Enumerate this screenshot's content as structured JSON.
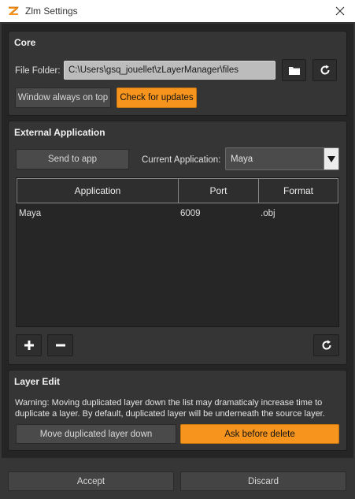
{
  "window": {
    "title": "Zlm Settings",
    "icon": "zbrush-logo-icon",
    "close_icon": "close-icon"
  },
  "core": {
    "title": "Core",
    "file_folder_label": "File Folder:",
    "file_folder_value": "C:\\Users\\gsq_jouellet\\zLayerManager\\files",
    "folder_icon": "folder-icon",
    "refresh_icon": "refresh-icon",
    "window_on_top_label": "Window always on top",
    "check_updates_label": "Check for updates"
  },
  "external": {
    "title": "External Application",
    "send_label": "Send to app",
    "current_app_label": "Current Application:",
    "current_app_value": "Maya",
    "table": {
      "columns": [
        "Application",
        "Port",
        "Format"
      ],
      "rows": [
        {
          "application": "Maya",
          "port": "6009",
          "format": ".obj"
        }
      ]
    },
    "add_icon": "plus-icon",
    "remove_icon": "minus-icon",
    "refresh_icon": "refresh-icon"
  },
  "layer_edit": {
    "title": "Layer Edit",
    "warning": "Warning: Moving duplicated layer down the list may dramaticaly increase time to duplicate a layer.  By default, duplicated layer will be underneath the source layer.",
    "move_down_label": "Move duplicated layer down",
    "ask_delete_label": "Ask before delete"
  },
  "footer": {
    "accept_label": "Accept",
    "discard_label": "Discard"
  },
  "colors": {
    "accent_orange": "#f7941d",
    "panel": "#353535",
    "background": "#252525"
  }
}
